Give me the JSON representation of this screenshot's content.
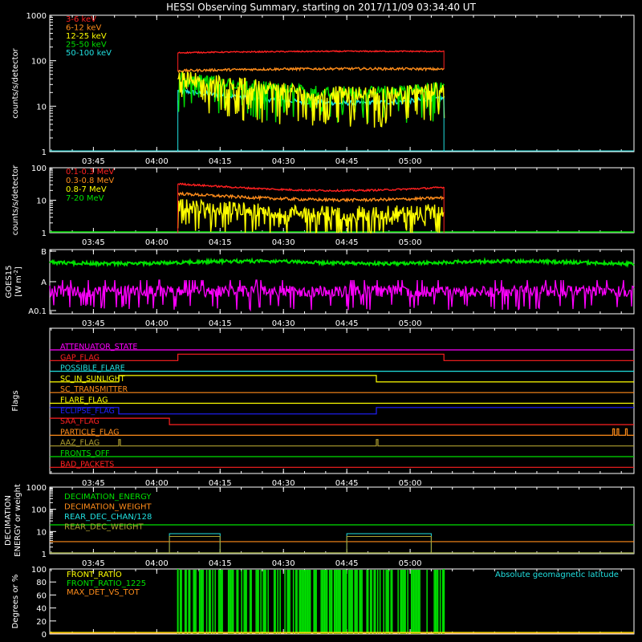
{
  "page_title": "HESSI Observing Summary, starting on 2017/11/09 03:34:40 UT",
  "time_ticks": [
    "03:45",
    "04:00",
    "04:15",
    "04:30",
    "04:45",
    "05:00"
  ],
  "colors": {
    "background": "#000000",
    "axis": "#ffffff",
    "red": "#ff2020",
    "orange": "#ff8c1a",
    "yellow": "#ffff00",
    "green": "#00e000",
    "cyan": "#20e0e0",
    "magenta": "#ff00ff",
    "blue": "#2020ff",
    "olive": "#b0a030"
  },
  "chart_data": [
    {
      "id": "lo",
      "type": "line",
      "ylabel": "counts/s/detector",
      "y_scale": "log",
      "ylim": [
        1,
        1000
      ],
      "yticks": [
        "1",
        "10",
        "100",
        "1000"
      ],
      "x_range": [
        "03:34:40",
        "05:53:00"
      ],
      "legend_position": "top-left",
      "data_interval": [
        "04:05",
        "05:08"
      ],
      "series": [
        {
          "name": "3-6 keV",
          "color": "#ff2020",
          "start": 150,
          "mid": 165,
          "end": 160,
          "noise": 0.03
        },
        {
          "name": "6-12 keV",
          "color": "#ff8c1a",
          "start": 60,
          "mid": 70,
          "end": 65,
          "noise": 0.06
        },
        {
          "name": "12-25 keV",
          "color": "#ffff00",
          "start": 45,
          "mid": 7,
          "end": 25,
          "noise": 0.35
        },
        {
          "name": "25-50 keV",
          "color": "#00e000",
          "start": 45,
          "mid": 9,
          "end": 28,
          "noise": 0.25
        },
        {
          "name": "50-100 keV",
          "color": "#20e0e0",
          "start": 22,
          "mid": 6,
          "end": 15,
          "noise": 0.12
        }
      ]
    },
    {
      "id": "hi",
      "type": "line",
      "ylabel": "counts/s/detector",
      "y_scale": "log",
      "ylim": [
        1,
        100
      ],
      "yticks": [
        "1",
        "10",
        "100"
      ],
      "legend_position": "top-left",
      "data_interval": [
        "04:05",
        "05:08"
      ],
      "series": [
        {
          "name": "0.1-0.3 MeV",
          "color": "#ff2020",
          "start": 32,
          "mid": 12,
          "end": 25,
          "noise": 0.06
        },
        {
          "name": "0.3-0.8 MeV",
          "color": "#ff8c1a",
          "start": 16,
          "mid": 7,
          "end": 12,
          "noise": 0.1
        },
        {
          "name": "0.8-7 MeV",
          "color": "#ffff00",
          "start": 7,
          "mid": 2.5,
          "end": 5,
          "noise": 0.5
        },
        {
          "name": "7-20 MeV",
          "color": "#00e000",
          "start": 1,
          "mid": 1,
          "end": 1,
          "noise": 0
        }
      ]
    },
    {
      "id": "goes",
      "type": "line",
      "ylabel": "GOES15 [W m⁻²]",
      "ylabel_parts": [
        "GOES15",
        "[W m",
        "-2",
        "]"
      ],
      "yticks": [
        "A0.1",
        "A",
        "B"
      ],
      "series": [
        {
          "name": "long channel",
          "color": "#00e000",
          "level": 0.78
        },
        {
          "name": "short channel",
          "color": "#ff00ff",
          "level": 0.3
        }
      ]
    },
    {
      "id": "flags",
      "type": "line",
      "ylabel": "Flags",
      "rows": [
        {
          "name": "ATTENUATOR_STATE",
          "color": "#ff00ff",
          "changes": []
        },
        {
          "name": "GAP_FLAG",
          "color": "#ff2020",
          "changes": [
            [
              "04:05",
              1
            ],
            [
              "05:08",
              0
            ]
          ]
        },
        {
          "name": "POSSIBLE_FLARE",
          "color": "#20e0e0",
          "changes": []
        },
        {
          "name": "SC_IN_SUNLIGHT",
          "color": "#ffff00",
          "changes": [
            [
              "03:51",
              1
            ],
            [
              "04:52",
              0
            ]
          ]
        },
        {
          "name": "SC_TRANSMITTER",
          "color": "#ff8c1a",
          "changes": []
        },
        {
          "name": "FLARE_FLAG",
          "color": "#ffff00",
          "changes": []
        },
        {
          "name": "ECLIPSE_FLAG",
          "color": "#2020ff",
          "changes": [
            [
              "03:51",
              0
            ],
            [
              "04:52",
              1
            ]
          ]
        },
        {
          "name": "SAA_FLAG",
          "color": "#ff2020",
          "changes": [
            [
              "04:03",
              0
            ]
          ]
        },
        {
          "name": "PARTICLE_FLAG",
          "color": "#ff8c1a",
          "spikes": [
            "05:48",
            "05:49",
            "05:51"
          ]
        },
        {
          "name": "AAZ_FLAG",
          "color": "#b0a030",
          "spikes": [
            "03:51",
            "04:52"
          ]
        },
        {
          "name": "FRONTS_OFF",
          "color": "#00e000",
          "changes": []
        },
        {
          "name": "BAD_PACKETS",
          "color": "#ff2020",
          "changes": []
        }
      ]
    },
    {
      "id": "decim",
      "type": "line",
      "ylabel": "DECIMATION ENERGY or weight",
      "ylabel_parts": [
        "DECIMATION",
        "ENERGY or weight"
      ],
      "y_scale": "log",
      "ylim": [
        1,
        1000
      ],
      "yticks": [
        "1",
        "10",
        "100",
        "1000"
      ],
      "legend_position": "top-left",
      "series": [
        {
          "name": "DECIMATION_ENERGY",
          "color": "#00e000",
          "value": 20
        },
        {
          "name": "DECIMATION_WEIGHT",
          "color": "#ff8c1a",
          "value": 3.5
        },
        {
          "name": "REAR_DEC_CHAN/128",
          "color": "#20e0e0",
          "value": 1,
          "boxes": [
            [
              "04:03",
              "04:15",
              8
            ],
            [
              "04:45",
              "05:05",
              8
            ]
          ]
        },
        {
          "name": "REAR_DEC_WEIGHT",
          "color": "#b0a030",
          "value": 1,
          "boxes": [
            [
              "04:03",
              "04:15",
              6
            ],
            [
              "04:45",
              "05:05",
              6
            ]
          ]
        }
      ]
    },
    {
      "id": "bottom",
      "type": "line",
      "ylabel": "Degrees or %",
      "ylim": [
        0,
        100
      ],
      "yticks": [
        "0",
        "20",
        "40",
        "60",
        "80",
        "100"
      ],
      "legend_position": "top-left",
      "annotation": "Absolute geomagnetic latitude",
      "series": [
        {
          "name": "FRONT_RATIO",
          "color": "#ffff00"
        },
        {
          "name": "FRONT_RATIO_1225",
          "color": "#00e000",
          "interval": [
            "04:05",
            "05:08"
          ]
        },
        {
          "name": "MAX_DET_VS_TOT",
          "color": "#ff8c1a"
        },
        {
          "name": "Absolute geomagnetic latitude",
          "color": "#20e0e0",
          "zeros": [
            "03:42",
            "04:30",
            "05:16"
          ],
          "peaks": [
            "04:06",
            "04:53"
          ],
          "peak_value": 44,
          "start_value": 22
        }
      ]
    }
  ]
}
